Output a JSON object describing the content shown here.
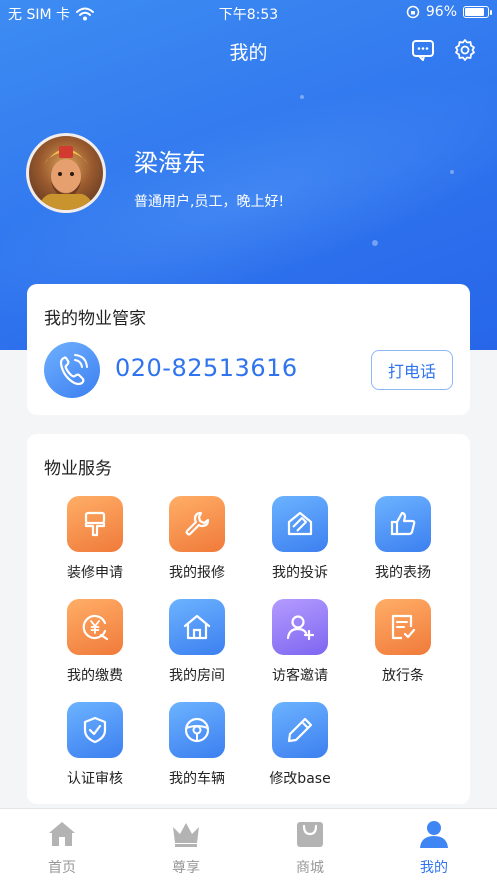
{
  "status_bar": {
    "carrier": "无 SIM 卡",
    "time": "下午8:53",
    "battery_pct": "96%",
    "battery_level": 0.96
  },
  "nav": {
    "title": "我的",
    "icons": [
      "message-icon",
      "settings-icon"
    ]
  },
  "profile": {
    "name": "梁海东",
    "subtitle": "普通用户,员工，晚上好!"
  },
  "manager": {
    "title": "我的物业管家",
    "phone": "020-82513616",
    "call_label": "打电话"
  },
  "services": {
    "title": "物业服务",
    "items": [
      {
        "label": "装修申请",
        "icon": "paint-brush-icon",
        "color": "#f48a44"
      },
      {
        "label": "我的报修",
        "icon": "wrench-icon",
        "color": "#f48a44"
      },
      {
        "label": "我的投诉",
        "icon": "complaint-envelope-icon",
        "color": "#4c8ff5"
      },
      {
        "label": "我的表扬",
        "icon": "thumbs-up-icon",
        "color": "#4c8ff5"
      },
      {
        "label": "我的缴费",
        "icon": "yuan-payment-icon",
        "color": "#f48a44"
      },
      {
        "label": "我的房间",
        "icon": "house-icon",
        "color": "#4c8ff5"
      },
      {
        "label": "访客邀请",
        "icon": "add-user-icon",
        "color": "#8b73f2"
      },
      {
        "label": "放行条",
        "icon": "pass-note-icon",
        "color": "#f48a44"
      },
      {
        "label": "认证审核",
        "icon": "shield-check-icon",
        "color": "#4c8ff5"
      },
      {
        "label": "我的车辆",
        "icon": "steering-wheel-icon",
        "color": "#4c8ff5"
      },
      {
        "label": "修改base",
        "icon": "pencil-icon",
        "color": "#4c8ff5"
      }
    ]
  },
  "tabbar": {
    "items": [
      {
        "label": "首页",
        "icon": "home-icon"
      },
      {
        "label": "尊享",
        "icon": "crown-icon"
      },
      {
        "label": "商城",
        "icon": "shopping-bag-icon"
      },
      {
        "label": "我的",
        "icon": "person-icon",
        "active": true
      }
    ]
  },
  "colors": {
    "primary": "#2f74ee",
    "tab_inactive": "#999999",
    "background": "#f4f5f7"
  }
}
